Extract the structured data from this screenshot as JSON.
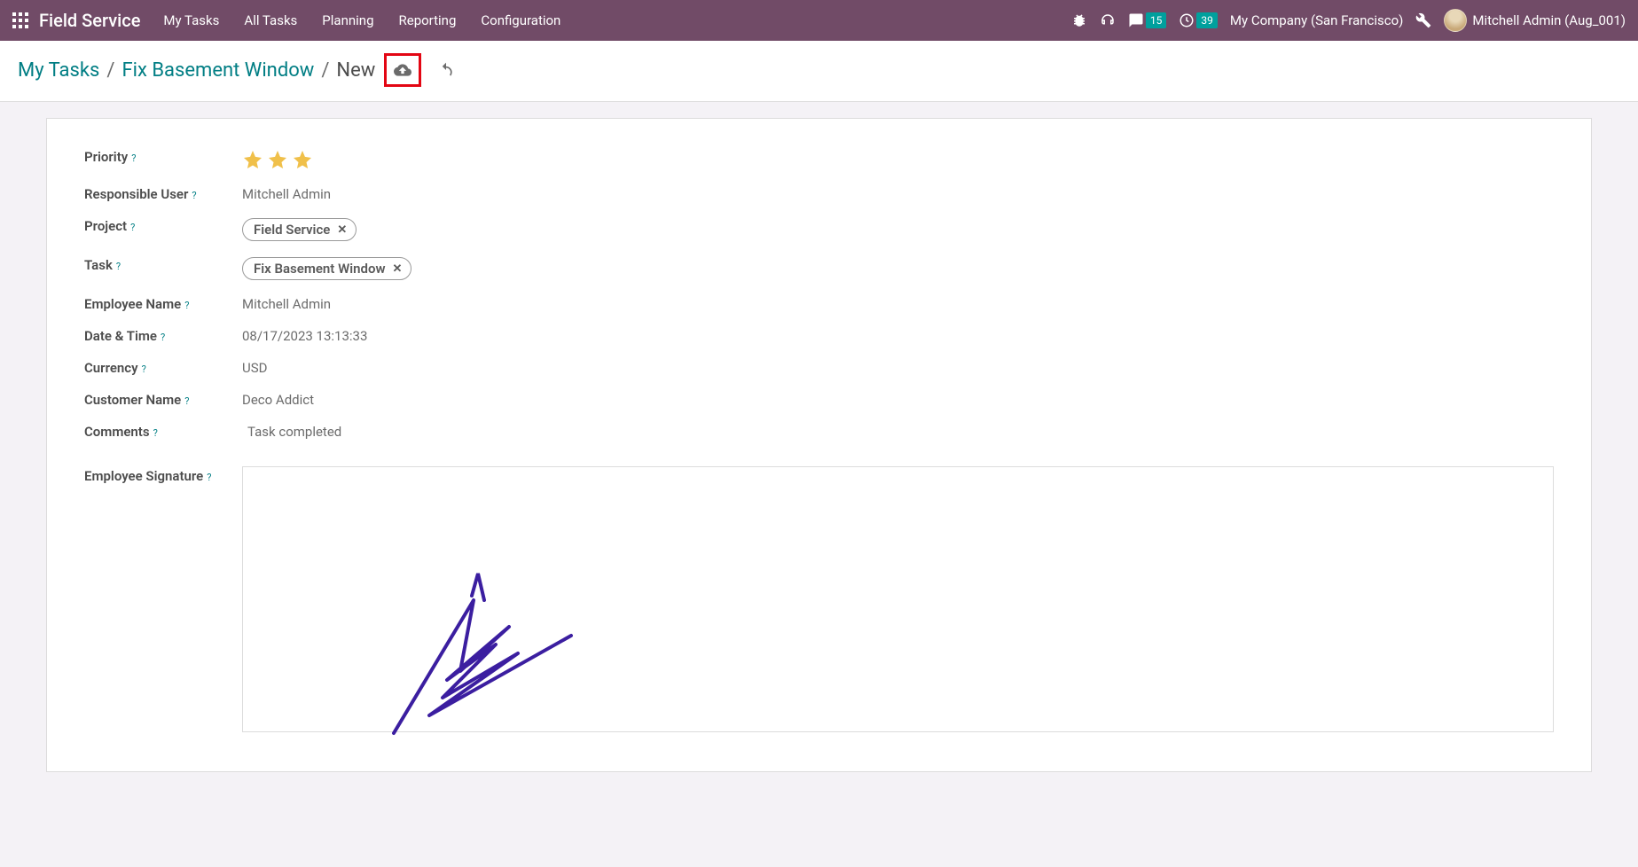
{
  "navbar": {
    "brand": "Field Service",
    "menu": [
      "My Tasks",
      "All Tasks",
      "Planning",
      "Reporting",
      "Configuration"
    ],
    "messages_badge": "15",
    "activities_badge": "39",
    "company": "My Company (San Francisco)",
    "user": "Mitchell Admin (Aug_001)"
  },
  "breadcrumb": {
    "level1": "My Tasks",
    "level2": "Fix Basement Window",
    "level3": "New"
  },
  "form": {
    "priority_label": "Priority",
    "priority_stars": 3,
    "responsible_label": "Responsible User",
    "responsible_value": "Mitchell Admin",
    "project_label": "Project",
    "project_tag": "Field Service",
    "task_label": "Task",
    "task_tag": "Fix Basement Window",
    "employee_label": "Employee Name",
    "employee_value": "Mitchell Admin",
    "datetime_label": "Date & Time",
    "datetime_value": "08/17/2023 13:13:33",
    "currency_label": "Currency",
    "currency_value": "USD",
    "customer_label": "Customer Name",
    "customer_value": "Deco Addict",
    "comments_label": "Comments",
    "comments_value": "Task completed",
    "signature_label": "Employee Signature"
  },
  "help_marker": "?"
}
